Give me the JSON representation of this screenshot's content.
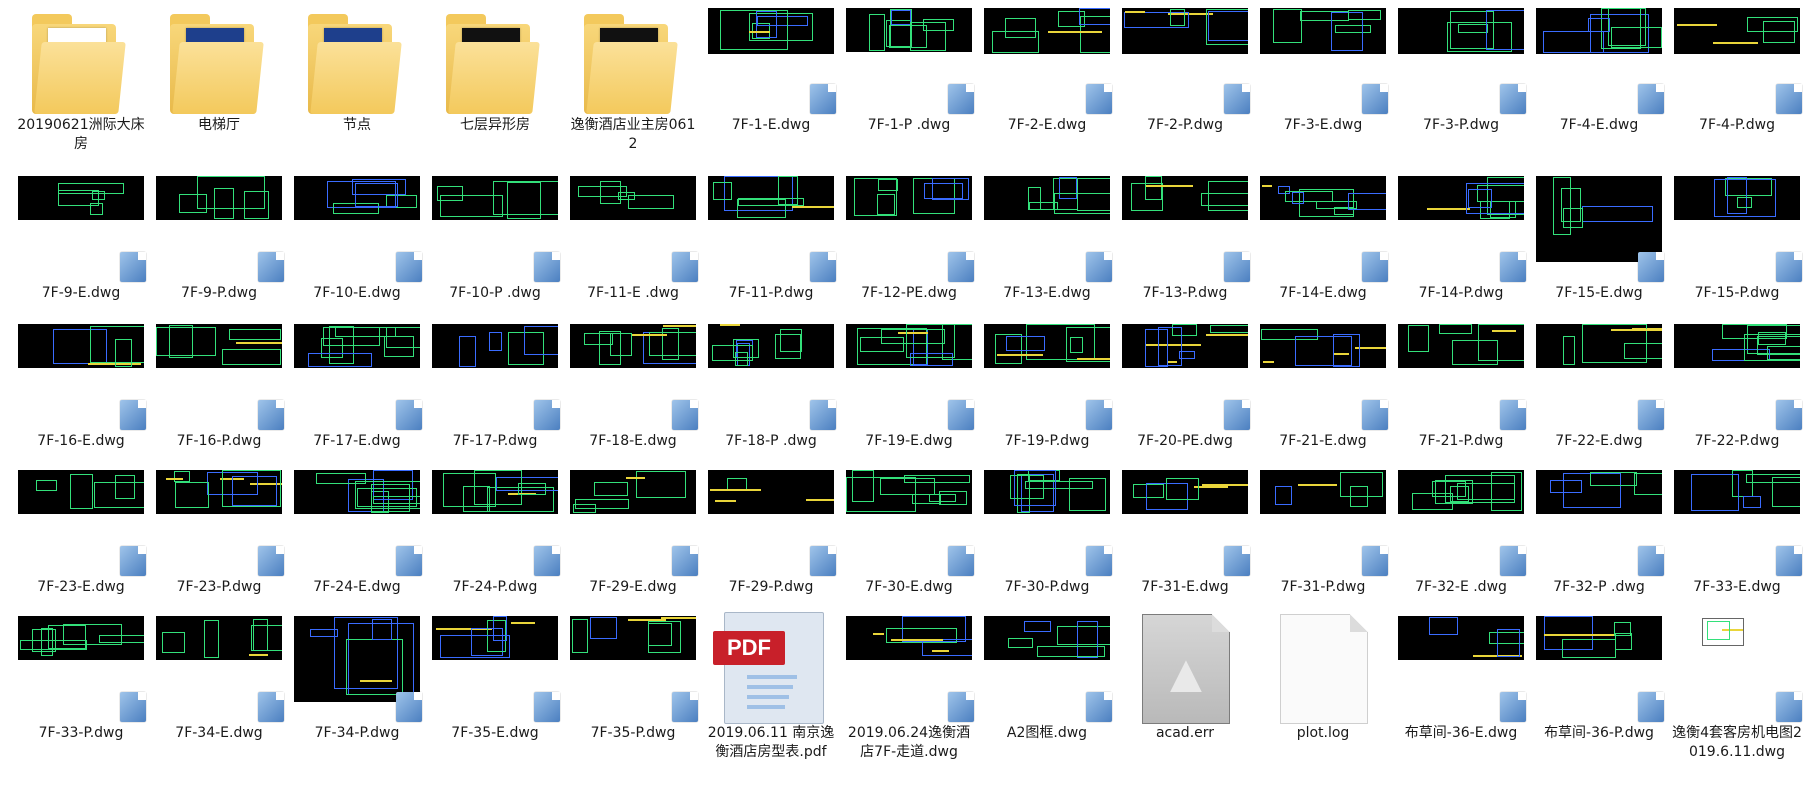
{
  "items": [
    {
      "name": "20190621洲际大床房",
      "type": "folder",
      "style": "plain"
    },
    {
      "name": "电梯厅",
      "type": "folder",
      "style": "blue"
    },
    {
      "name": "节点",
      "type": "folder",
      "style": "blue"
    },
    {
      "name": "七层异形房",
      "type": "folder",
      "style": "dark"
    },
    {
      "name": "逸衡酒店业主房0612",
      "type": "folder",
      "style": "dark"
    },
    {
      "name": "7F-1-E.dwg",
      "type": "dwg",
      "thumb": "tall"
    },
    {
      "name": "7F-1-P .dwg",
      "type": "dwg",
      "thumb": "short"
    },
    {
      "name": "7F-2-E.dwg",
      "type": "dwg",
      "thumb": "tall"
    },
    {
      "name": "7F-2-P.dwg",
      "type": "dwg",
      "thumb": "tall"
    },
    {
      "name": "7F-3-E.dwg",
      "type": "dwg",
      "thumb": "tall"
    },
    {
      "name": "7F-3-P.dwg",
      "type": "dwg",
      "thumb": "tall"
    },
    {
      "name": "7F-4-E.dwg",
      "type": "dwg",
      "thumb": "tall"
    },
    {
      "name": "7F-4-P.dwg",
      "type": "dwg",
      "thumb": "tall"
    },
    {
      "name": "7F-9-E.dwg",
      "type": "dwg",
      "thumb": "mid"
    },
    {
      "name": "7F-9-P.dwg",
      "type": "dwg",
      "thumb": "mid"
    },
    {
      "name": "7F-10-E.dwg",
      "type": "dwg",
      "thumb": "mid"
    },
    {
      "name": "7F-10-P .dwg",
      "type": "dwg",
      "thumb": "mid"
    },
    {
      "name": "7F-11-E .dwg",
      "type": "dwg",
      "thumb": "mid"
    },
    {
      "name": "7F-11-P.dwg",
      "type": "dwg",
      "thumb": "mid"
    },
    {
      "name": "7F-12-PE.dwg",
      "type": "dwg",
      "thumb": "mid"
    },
    {
      "name": "7F-13-E.dwg",
      "type": "dwg",
      "thumb": "mid"
    },
    {
      "name": "7F-13-P.dwg",
      "type": "dwg",
      "thumb": "mid"
    },
    {
      "name": "7F-14-E.dwg",
      "type": "dwg",
      "thumb": "mid"
    },
    {
      "name": "7F-14-P.dwg",
      "type": "dwg",
      "thumb": "mid"
    },
    {
      "name": "7F-15-E.dwg",
      "type": "dwg",
      "thumb": "big"
    },
    {
      "name": "7F-15-P.dwg",
      "type": "dwg",
      "thumb": "mid"
    },
    {
      "name": "7F-16-E.dwg",
      "type": "dwg",
      "thumb": "mid"
    },
    {
      "name": "7F-16-P.dwg",
      "type": "dwg",
      "thumb": "mid"
    },
    {
      "name": "7F-17-E.dwg",
      "type": "dwg",
      "thumb": "mid"
    },
    {
      "name": "7F-17-P.dwg",
      "type": "dwg",
      "thumb": "mid"
    },
    {
      "name": "7F-18-E.dwg",
      "type": "dwg",
      "thumb": "mid"
    },
    {
      "name": "7F-18-P .dwg",
      "type": "dwg",
      "thumb": "mid"
    },
    {
      "name": "7F-19-E.dwg",
      "type": "dwg",
      "thumb": "mid"
    },
    {
      "name": "7F-19-P.dwg",
      "type": "dwg",
      "thumb": "mid"
    },
    {
      "name": "7F-20-PE.dwg",
      "type": "dwg",
      "thumb": "mid"
    },
    {
      "name": "7F-21-E.dwg",
      "type": "dwg",
      "thumb": "mid"
    },
    {
      "name": "7F-21-P.dwg",
      "type": "dwg",
      "thumb": "mid"
    },
    {
      "name": "7F-22-E.dwg",
      "type": "dwg",
      "thumb": "mid"
    },
    {
      "name": "7F-22-P.dwg",
      "type": "dwg",
      "thumb": "mid"
    },
    {
      "name": "7F-23-E.dwg",
      "type": "dwg",
      "thumb": "mid"
    },
    {
      "name": "7F-23-P.dwg",
      "type": "dwg",
      "thumb": "mid"
    },
    {
      "name": "7F-24-E.dwg",
      "type": "dwg",
      "thumb": "mid"
    },
    {
      "name": "7F-24-P.dwg",
      "type": "dwg",
      "thumb": "mid"
    },
    {
      "name": "7F-29-E.dwg",
      "type": "dwg",
      "thumb": "mid"
    },
    {
      "name": "7F-29-P.dwg",
      "type": "dwg",
      "thumb": "mid"
    },
    {
      "name": "7F-30-E.dwg",
      "type": "dwg",
      "thumb": "mid"
    },
    {
      "name": "7F-30-P.dwg",
      "type": "dwg",
      "thumb": "mid"
    },
    {
      "name": "7F-31-E.dwg",
      "type": "dwg",
      "thumb": "mid"
    },
    {
      "name": "7F-31-P.dwg",
      "type": "dwg",
      "thumb": "mid"
    },
    {
      "name": "7F-32-E .dwg",
      "type": "dwg",
      "thumb": "mid"
    },
    {
      "name": "7F-32-P .dwg",
      "type": "dwg",
      "thumb": "mid"
    },
    {
      "name": "7F-33-E.dwg",
      "type": "dwg",
      "thumb": "mid"
    },
    {
      "name": "7F-33-P.dwg",
      "type": "dwg",
      "thumb": "mid"
    },
    {
      "name": "7F-34-E.dwg",
      "type": "dwg",
      "thumb": "mid"
    },
    {
      "name": "7F-34-P.dwg",
      "type": "dwg",
      "thumb": "big"
    },
    {
      "name": "7F-35-E.dwg",
      "type": "dwg",
      "thumb": "mid"
    },
    {
      "name": "7F-35-P.dwg",
      "type": "dwg",
      "thumb": "mid"
    },
    {
      "name": "2019.06.11 南京逸衡酒店房型表.pdf",
      "type": "pdf",
      "pdf_label": "PDF"
    },
    {
      "name": "2019.06.24逸衡酒店7F-走道.dwg",
      "type": "dwg",
      "thumb": "mid"
    },
    {
      "name": "A2图框.dwg",
      "type": "dwg",
      "thumb": "mid"
    },
    {
      "name": "acad.err",
      "type": "err"
    },
    {
      "name": "plot.log",
      "type": "log"
    },
    {
      "name": "布草间-36-E.dwg",
      "type": "dwg",
      "thumb": "mid"
    },
    {
      "name": "布草间-36-P.dwg",
      "type": "dwg",
      "thumb": "mid"
    },
    {
      "name": "逸衡4套客房机电图2019.6.11.dwg",
      "type": "dwg",
      "thumb": "tiny"
    }
  ],
  "colors": {
    "cad_line": "#33e07a",
    "cad_yellow": "#e9d53a",
    "cad_blue": "#3a6cff",
    "pdf_red": "#c8202a"
  }
}
